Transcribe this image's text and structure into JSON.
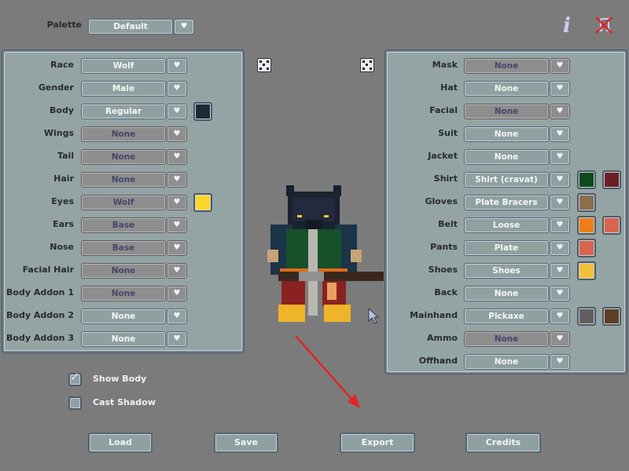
{
  "palette": {
    "label": "Palette",
    "value": "Default"
  },
  "top_icons": {
    "info": "info-icon",
    "music": "music-muted-icon"
  },
  "dropdown_arrow_icon": "heart-chevron-icon",
  "left_panel": {
    "rows": [
      {
        "label": "Race",
        "value": "Wolf",
        "enabled": true,
        "colors": []
      },
      {
        "label": "Gender",
        "value": "Male",
        "enabled": true,
        "colors": []
      },
      {
        "label": "Body",
        "value": "Regular",
        "enabled": true,
        "colors": [
          "#1c2a36"
        ]
      },
      {
        "label": "Wings",
        "value": "None",
        "enabled": false,
        "colors": []
      },
      {
        "label": "Tail",
        "value": "None",
        "enabled": false,
        "colors": []
      },
      {
        "label": "Hair",
        "value": "None",
        "enabled": false,
        "colors": []
      },
      {
        "label": "Eyes",
        "value": "Wolf",
        "enabled": false,
        "colors": [
          "#fcd72a"
        ]
      },
      {
        "label": "Ears",
        "value": "Base",
        "enabled": false,
        "colors": []
      },
      {
        "label": "Nose",
        "value": "Base",
        "enabled": false,
        "colors": []
      },
      {
        "label": "Facial Hair",
        "value": "None",
        "enabled": false,
        "colors": []
      },
      {
        "label": "Body Addon 1",
        "value": "None",
        "enabled": false,
        "colors": []
      },
      {
        "label": "Body Addon 2",
        "value": "None",
        "enabled": true,
        "colors": []
      },
      {
        "label": "Body Addon 3",
        "value": "None",
        "enabled": true,
        "colors": []
      }
    ]
  },
  "right_panel": {
    "rows": [
      {
        "label": "Mask",
        "value": "None",
        "enabled": false,
        "colors": []
      },
      {
        "label": "Hat",
        "value": "None",
        "enabled": true,
        "colors": []
      },
      {
        "label": "Facial",
        "value": "None",
        "enabled": false,
        "colors": []
      },
      {
        "label": "Suit",
        "value": "None",
        "enabled": true,
        "colors": []
      },
      {
        "label": "Jacket",
        "value": "None",
        "enabled": true,
        "colors": []
      },
      {
        "label": "Shirt",
        "value": "Shirt (cravat)",
        "enabled": true,
        "colors": [
          "#0d4a1c",
          "#6a2024"
        ]
      },
      {
        "label": "Gloves",
        "value": "Plate Bracers",
        "enabled": true,
        "colors": [
          "#8a6e4e"
        ]
      },
      {
        "label": "Belt",
        "value": "Loose",
        "enabled": true,
        "colors": [
          "#f07c18",
          "#d8664e"
        ]
      },
      {
        "label": "Pants",
        "value": "Plate",
        "enabled": true,
        "colors": [
          "#d8664e"
        ]
      },
      {
        "label": "Shoes",
        "value": "Shoes",
        "enabled": true,
        "colors": [
          "#f4c03c"
        ]
      },
      {
        "label": "Back",
        "value": "None",
        "enabled": true,
        "colors": []
      },
      {
        "label": "Mainhand",
        "value": "Pickaxe",
        "enabled": true,
        "colors": [
          "#625e60",
          "#5e3e28"
        ]
      },
      {
        "label": "Ammo",
        "value": "None",
        "enabled": false,
        "colors": []
      },
      {
        "label": "Offhand",
        "value": "None",
        "enabled": true,
        "colors": []
      }
    ]
  },
  "options": {
    "show_body": {
      "label": "Show Body",
      "checked": true
    },
    "cast_shadow": {
      "label": "Cast Shadow",
      "checked": false
    }
  },
  "buttons": {
    "load": "Load",
    "save": "Save",
    "export": "Export",
    "credits": "Credits"
  },
  "annotation_color": "#e02424"
}
